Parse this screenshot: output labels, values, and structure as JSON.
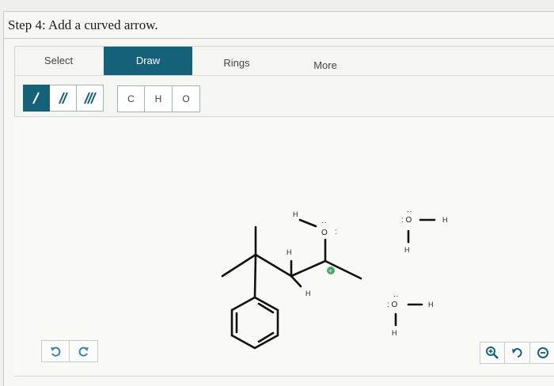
{
  "step": {
    "title": "Step 4: Add a curved arrow."
  },
  "tabs": [
    {
      "label": "Select"
    },
    {
      "label": "Draw"
    },
    {
      "label": "Rings"
    },
    {
      "label": "More"
    }
  ],
  "active_tab": "Draw",
  "bond_buttons": [
    {
      "icon": "single-bond-icon"
    },
    {
      "icon": "double-bond-icon"
    },
    {
      "icon": "triple-bond-icon"
    }
  ],
  "atom_buttons": [
    {
      "label": "C"
    },
    {
      "label": "H"
    },
    {
      "label": "O"
    }
  ],
  "molecule": {
    "h_top": "H",
    "o_top": "O",
    "o_top_lp": ":",
    "o_top_dots": "··",
    "h_mid": "H",
    "h_low": "H",
    "plus": "+"
  },
  "water1": {
    "o": ": O",
    "dots": "··",
    "h_right": "H",
    "h_below": "H"
  },
  "water2": {
    "o": ": O",
    "dots": "··",
    "h_right": "H",
    "h_below": "H"
  },
  "colors": {
    "accent": "#15617a",
    "undo": "#3d86a3",
    "zoom": "#15617a",
    "plus_badge": "#4aa86a"
  }
}
